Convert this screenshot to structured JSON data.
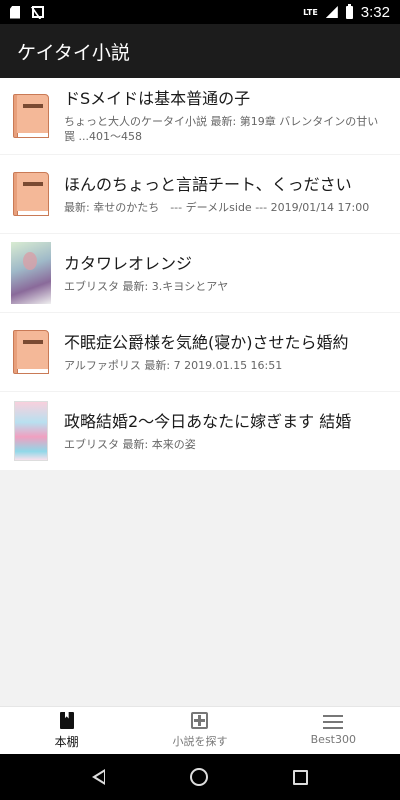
{
  "status_bar": {
    "time": "3:32",
    "network": "LTE",
    "icons": [
      "sd-card-icon",
      "n-icon",
      "signal-icon",
      "battery-icon"
    ]
  },
  "app_bar": {
    "title": "ケイタイ小説"
  },
  "books": [
    {
      "title": "ドSメイドは基本普通の子",
      "meta": "ちょっと大人のケータイ小説 最新: 第19章 バレンタインの甘い罠 ...401〜458",
      "thumb": "book-icon"
    },
    {
      "title": "ほんのちょっと言語チート、くっださい",
      "meta": "最新: 幸せのかたち　--- デーメルside --- 2019/01/14 17:00",
      "thumb": "book-icon"
    },
    {
      "title": "カタワレオレンジ",
      "meta": "エブリスタ 最新: 3.キヨシとアヤ",
      "thumb": "cover-image"
    },
    {
      "title": "不眠症公爵様を気絶(寝か)させたら婚約",
      "meta": "アルファポリス 最新: 7 2019.01.15 16:51",
      "thumb": "book-icon"
    },
    {
      "title": "政略結婚2〜今日あなたに嫁ぎます 結婚",
      "meta": "エブリスタ 最新: 本来の姿",
      "thumb": "cover-image"
    }
  ],
  "bottom_nav": [
    {
      "label": "本棚",
      "icon": "bookshelf-icon",
      "active": true
    },
    {
      "label": "小説を探す",
      "icon": "add-box-icon",
      "active": false
    },
    {
      "label": "Best300",
      "icon": "menu-icon",
      "active": false
    }
  ],
  "colors": {
    "app_bar": "#1c1c1c",
    "list_background": "#f2f2f2",
    "book_icon": "#f4b898"
  }
}
